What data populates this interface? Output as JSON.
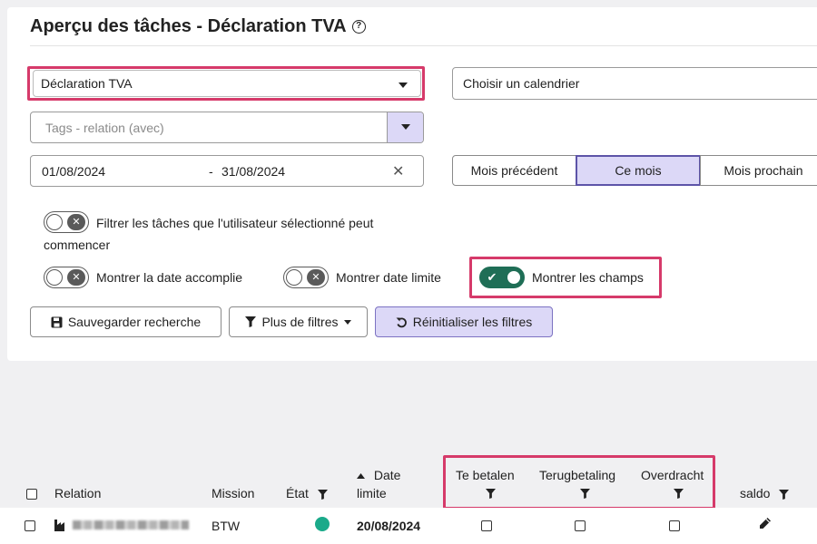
{
  "header": {
    "title": "Aperçu des tâches - Déclaration TVA",
    "help_glyph": "?"
  },
  "filters": {
    "declaration_select": "Déclaration TVA",
    "calendar_select": "Choisir un calendrier",
    "tags_placeholder": "Tags - relation (avec)",
    "date_from": "01/08/2024",
    "date_sep": "-",
    "date_to": "31/08/2024",
    "clear_glyph": "✕",
    "period": {
      "previous": "Mois précédent",
      "current": "Ce mois",
      "next": "Mois prochain"
    },
    "toggles": {
      "filter_startable_line1": "Filtrer les tâches que l'utilisateur sélectionné peut",
      "filter_startable_line2": "commencer",
      "show_completed_date": "Montrer la date accomplie",
      "show_deadline": "Montrer date limite",
      "show_fields": "Montrer les champs"
    },
    "toggle_off_glyph": "✕",
    "toggle_on_glyph": "✔"
  },
  "actions": {
    "save_search": "Sauvegarder recherche",
    "more_filters": "Plus de filtres",
    "reset_filters": "Réinitialiser les filtres"
  },
  "table": {
    "headers": {
      "relation": "Relation",
      "mission": "Mission",
      "state": "État",
      "date_line1": "Date",
      "date_line2": "limite",
      "te_betalen": "Te betalen",
      "terugbetaling": "Terugbetaling",
      "overdracht": "Overdracht",
      "saldo": "saldo"
    },
    "rows": [
      {
        "mission": "BTW",
        "state_color": "#1aaa8a",
        "date": "20/08/2024"
      }
    ]
  },
  "colors": {
    "highlight": "#d63a6a",
    "accent_purple": "#dcd8f7",
    "toggle_on": "#1f6e56"
  }
}
